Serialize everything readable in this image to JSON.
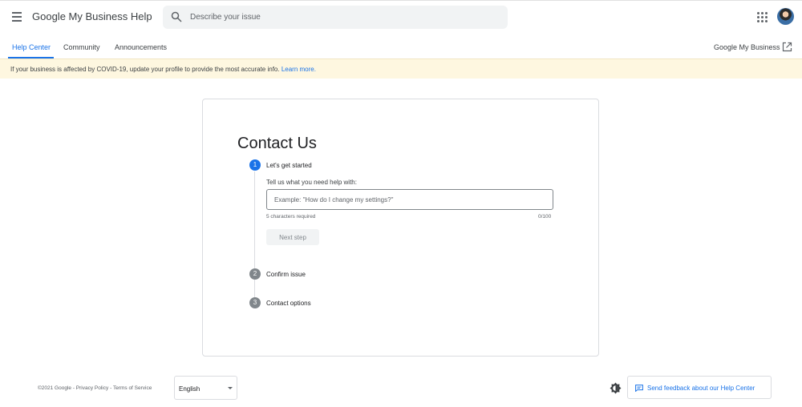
{
  "header": {
    "title": "Google My Business Help",
    "search_placeholder": "Describe your issue"
  },
  "tabs": [
    {
      "label": "Help Center",
      "active": true
    },
    {
      "label": "Community",
      "active": false
    },
    {
      "label": "Announcements",
      "active": false
    }
  ],
  "external_link": {
    "label": "Google My Business"
  },
  "banner": {
    "text": "If your business is affected by COVID-19, update your profile to provide the most accurate info.",
    "link": "Learn more."
  },
  "contact": {
    "title": "Contact Us",
    "steps": [
      {
        "number": "1",
        "label": "Let's get started",
        "active": true
      },
      {
        "number": "2",
        "label": "Confirm issue",
        "active": false
      },
      {
        "number": "3",
        "label": "Contact options",
        "active": false
      }
    ],
    "prompt": "Tell us what you need help with:",
    "input_placeholder": "Example: \"How do I change my settings?\"",
    "helper": "5 characters required",
    "counter": "0/100",
    "next_button": "Next step"
  },
  "footer": {
    "copyright": "©2021 Google",
    "separator": " - ",
    "privacy": "Privacy Policy",
    "terms": "Terms of Service",
    "language": "English",
    "feedback": "Send feedback about our Help Center"
  },
  "colors": {
    "accent": "#1a73e8",
    "banner_bg": "#fef7e0",
    "inactive_step": "#80868b"
  },
  "icons": [
    "menu-icon",
    "search-icon",
    "apps-grid-icon",
    "avatar",
    "open-in-new-icon",
    "dropdown-caret-icon",
    "theme-toggle-icon",
    "feedback-icon"
  ]
}
